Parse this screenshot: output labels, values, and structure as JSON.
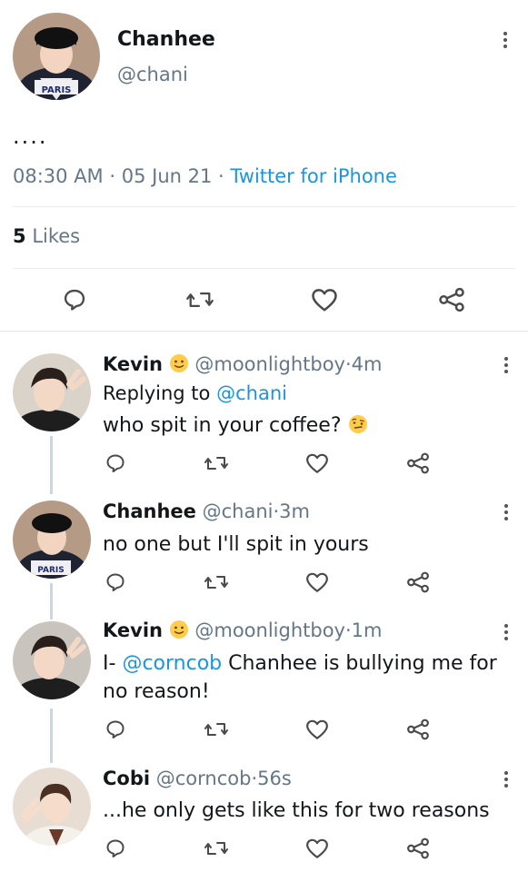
{
  "main_tweet": {
    "name": "Chanhee",
    "handle": "@chani",
    "text": "....",
    "time": "08:30 AM",
    "date": "05 Jun 21",
    "source": "Twitter for iPhone",
    "likes_count": "5",
    "likes_label": "Likes",
    "avatar_shirt_text": "PARIS"
  },
  "replies": [
    {
      "name": "Kevin",
      "emoji": "slightly-smiling-face",
      "handle": "@moonlightboy",
      "time": "4m",
      "replying_prefix": "Replying to",
      "replying_to": "@chani",
      "text": "who spit in your coffee?",
      "trailing_emoji": "face-with-raised-eyebrow"
    },
    {
      "name": "Chanhee",
      "handle": "@chani",
      "time": "3m",
      "text": "no one but I'll spit in yours",
      "avatar_shirt_text": "PARIS"
    },
    {
      "name": "Kevin",
      "emoji": "slightly-smiling-face",
      "handle": "@moonlightboy",
      "time": "1m",
      "text_prefix": "I-",
      "mention": "@corncob",
      "text_rest": "Chanhee is bullying me for",
      "text_line2": "no reason!"
    },
    {
      "name": "Cobi",
      "handle": "@corncob",
      "time": "56s",
      "text": "...he only gets like this for two reasons"
    }
  ],
  "separator": "·",
  "colors": {
    "link": "#1b95e0",
    "muted": "#657786",
    "text": "#14171a",
    "divider": "#e6ecf0",
    "thread_line": "#ccd6dd"
  },
  "icons": [
    "reply-icon",
    "retweet-icon",
    "like-icon",
    "share-icon",
    "more-options-icon"
  ]
}
